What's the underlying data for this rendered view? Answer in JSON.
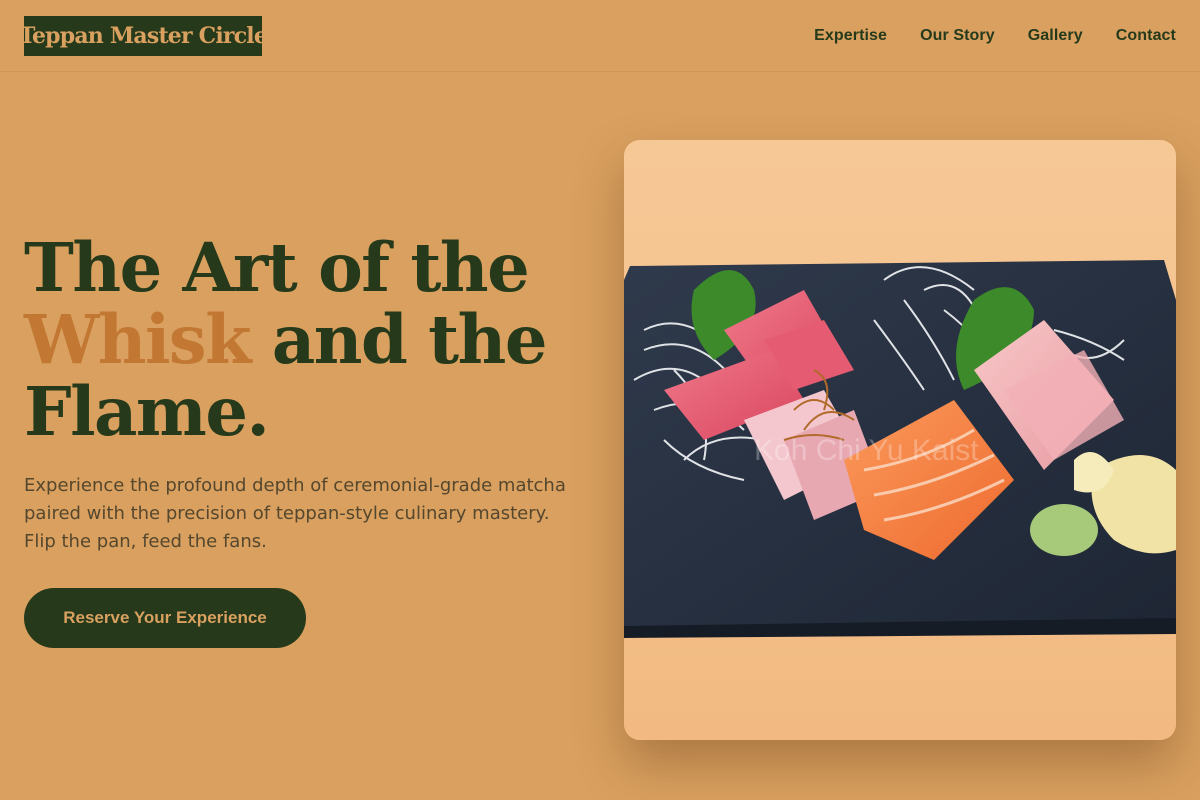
{
  "header": {
    "logo": "Teppan Master Circle",
    "nav": [
      {
        "label": "Expertise"
      },
      {
        "label": "Our Story"
      },
      {
        "label": "Gallery"
      },
      {
        "label": "Contact"
      }
    ]
  },
  "hero": {
    "headline_line1": "The Art of the",
    "headline_accent": "Whisk",
    "headline_line2_rest": " and the",
    "headline_line3": "Flame.",
    "subtitle": "Experience the profound depth of ceremonial-grade matcha paired with the precision of teppan-style culinary mastery. Flip the pan, feed the fans.",
    "cta_label": "Reserve Your Experience",
    "image": {
      "subject": "sashimi-platter-on-slate",
      "watermark": "Koh Chi Yu Kaist"
    }
  },
  "colors": {
    "background": "#d9a05f",
    "primary": "#263a1b",
    "accent": "#c27832",
    "body_text": "#55472e"
  }
}
